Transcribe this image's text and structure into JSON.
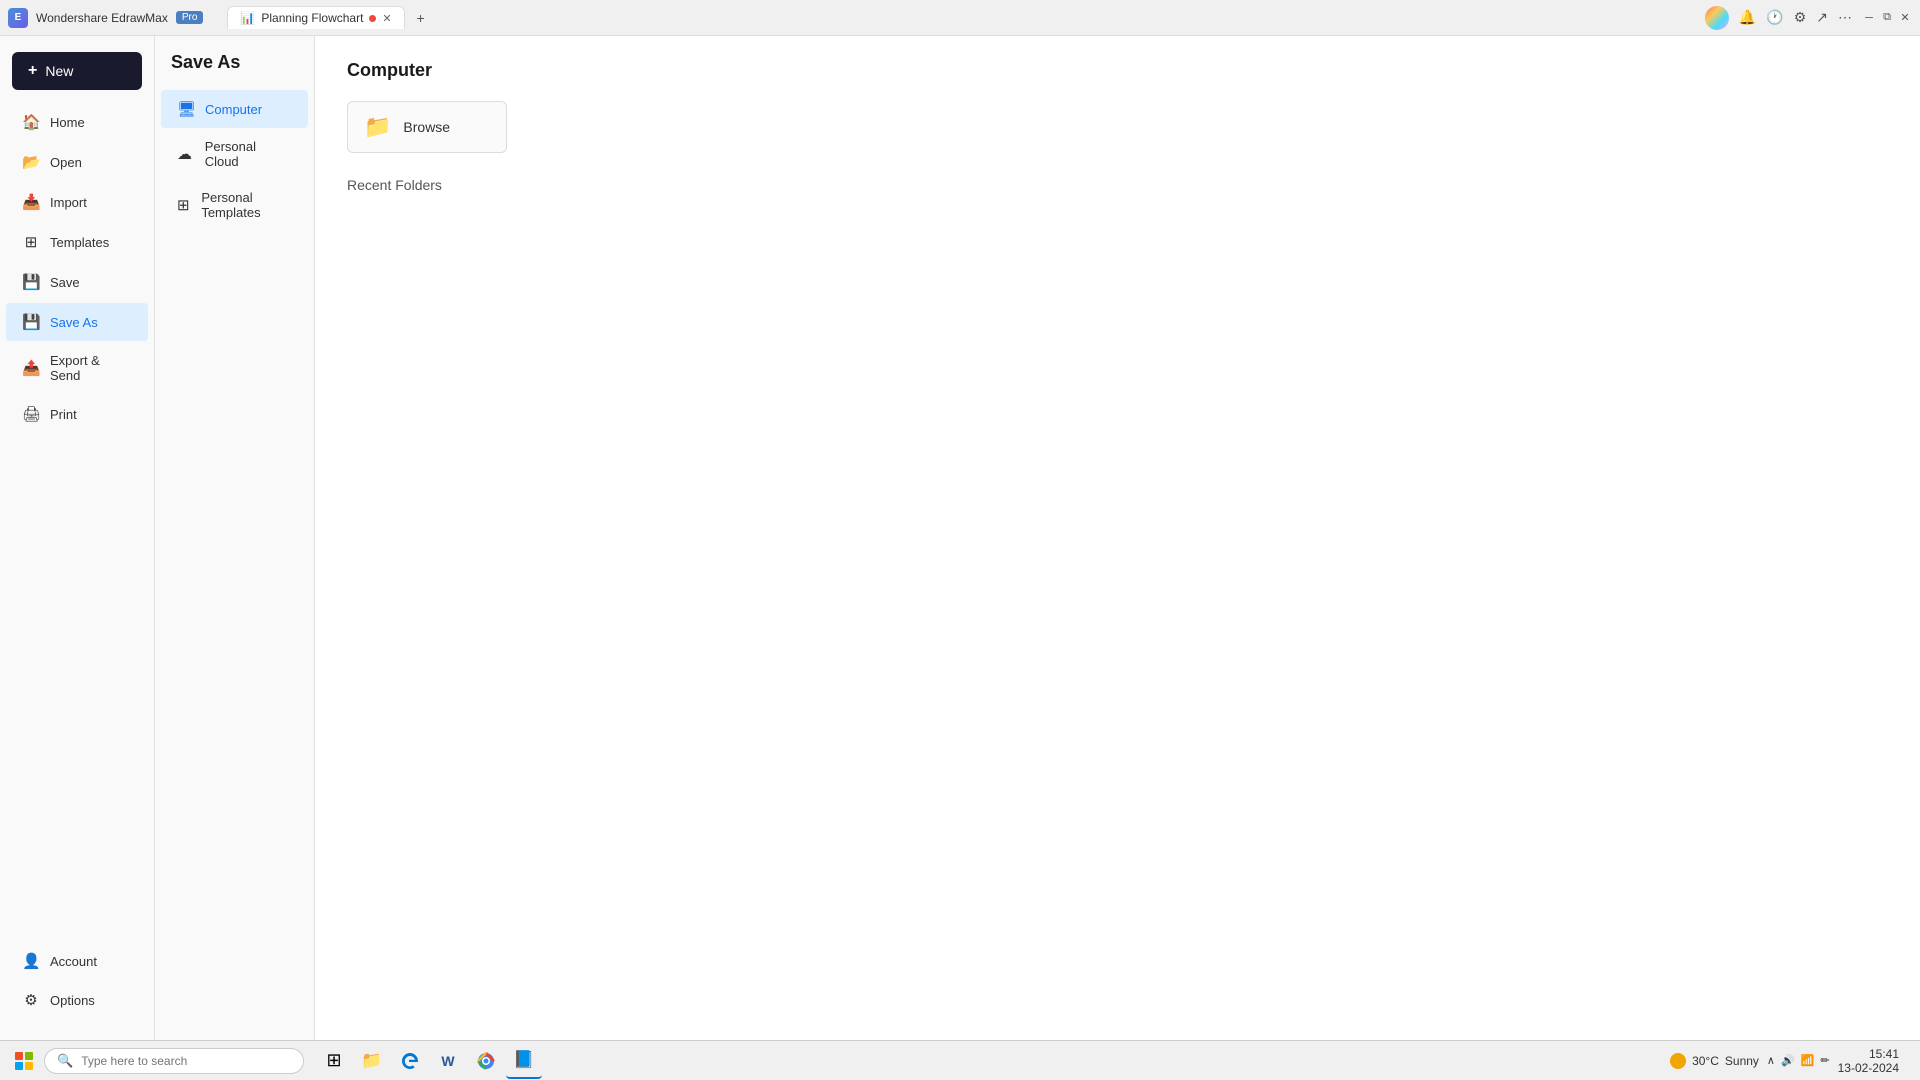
{
  "titlebar": {
    "app_name": "Wondershare EdrawMax",
    "badge": "Pro",
    "tab_label": "Planning Flowchart",
    "plus_label": "+"
  },
  "sidebar": {
    "new_label": "New",
    "items": [
      {
        "id": "home",
        "label": "Home",
        "icon": "🏠"
      },
      {
        "id": "open",
        "label": "Open",
        "icon": "📂"
      },
      {
        "id": "import",
        "label": "Import",
        "icon": "📥"
      },
      {
        "id": "templates",
        "label": "Templates",
        "icon": "⊞"
      },
      {
        "id": "save",
        "label": "Save",
        "icon": "💾"
      },
      {
        "id": "save-as",
        "label": "Save As",
        "icon": "💾",
        "active": true
      },
      {
        "id": "export",
        "label": "Export & Send",
        "icon": "📤"
      },
      {
        "id": "print",
        "label": "Print",
        "icon": "🖨"
      }
    ],
    "bottom_items": [
      {
        "id": "account",
        "label": "Account",
        "icon": "👤"
      },
      {
        "id": "options",
        "label": "Options",
        "icon": "⚙"
      }
    ]
  },
  "middle_panel": {
    "title": "Save As",
    "options": [
      {
        "id": "computer",
        "label": "Computer",
        "icon": "🖥",
        "active": true
      },
      {
        "id": "personal-cloud",
        "label": "Personal Cloud",
        "icon": "☁"
      },
      {
        "id": "personal-templates",
        "label": "Personal Templates",
        "icon": "⊞"
      }
    ]
  },
  "main_content": {
    "title": "Computer",
    "browse_label": "Browse",
    "recent_folders_label": "Recent Folders"
  },
  "taskbar": {
    "search_placeholder": "Type here to search",
    "apps": [
      {
        "id": "widgets",
        "icon": "⊞",
        "label": "Widgets"
      },
      {
        "id": "file-explorer",
        "icon": "📁",
        "label": "File Explorer"
      },
      {
        "id": "edge",
        "icon": "🌐",
        "label": "Microsoft Edge"
      },
      {
        "id": "word",
        "icon": "W",
        "label": "Word"
      },
      {
        "id": "chrome",
        "icon": "🔵",
        "label": "Chrome"
      },
      {
        "id": "edraw",
        "icon": "📘",
        "label": "EdrawMax"
      }
    ],
    "weather": {
      "temp": "30°C",
      "condition": "Sunny"
    },
    "clock": {
      "time": "15:41",
      "date": "13-02-2024"
    }
  }
}
